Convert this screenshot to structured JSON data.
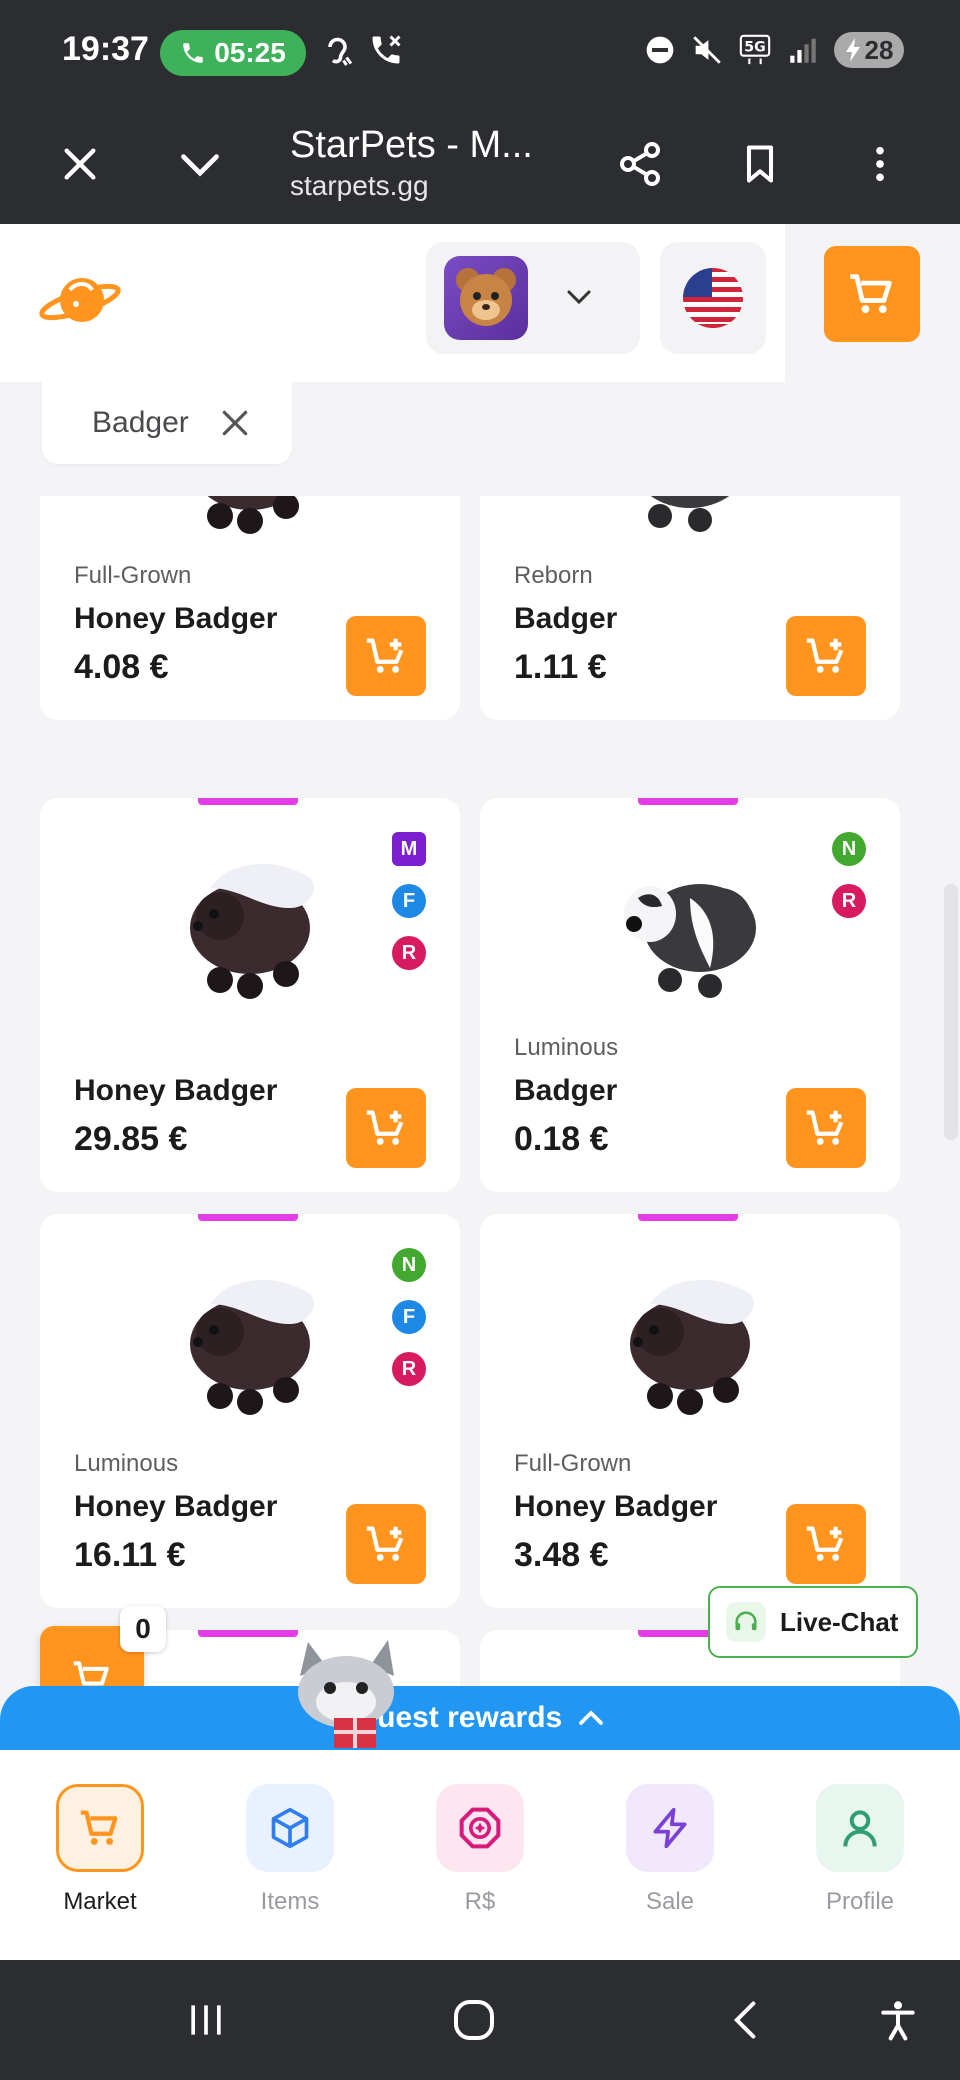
{
  "status_bar": {
    "time": "19:37",
    "call_timer": "05:25",
    "battery": "28"
  },
  "browser": {
    "title": "StarPets - M...",
    "url": "starpets.gg"
  },
  "filter": {
    "chip_label": "Badger"
  },
  "products": [
    {
      "subtitle": "Full-Grown",
      "name": "Honey Badger",
      "price": "4.08 €",
      "badges": []
    },
    {
      "subtitle": "Reborn",
      "name": "Badger",
      "price": "1.11 €",
      "badges": []
    },
    {
      "subtitle": "",
      "name": "Honey Badger",
      "price": "29.85 €",
      "badges": [
        {
          "letter": "M",
          "color": "#7b1fd1"
        },
        {
          "letter": "F",
          "color": "#1e88e5"
        },
        {
          "letter": "R",
          "color": "#d81b60"
        }
      ]
    },
    {
      "subtitle": "Luminous",
      "name": "Badger",
      "price": "0.18 €",
      "badges": [
        {
          "letter": "N",
          "color": "#43a82f"
        },
        {
          "letter": "R",
          "color": "#d81b60"
        }
      ]
    },
    {
      "subtitle": "Luminous",
      "name": "Honey Badger",
      "price": "16.11 €",
      "badges": [
        {
          "letter": "N",
          "color": "#43a82f"
        },
        {
          "letter": "F",
          "color": "#1e88e5"
        },
        {
          "letter": "R",
          "color": "#d81b60"
        }
      ]
    },
    {
      "subtitle": "Full-Grown",
      "name": "Honey Badger",
      "price": "3.48 €",
      "badges": []
    }
  ],
  "floating": {
    "cart_count": "0",
    "live_chat_label": "Live-Chat",
    "quest_label": "Quest rewards"
  },
  "bottom_nav": [
    {
      "label": "Market",
      "icon": "cart-icon",
      "active": true
    },
    {
      "label": "Items",
      "icon": "cube-icon",
      "active": false
    },
    {
      "label": "R$",
      "icon": "robux-icon",
      "active": false
    },
    {
      "label": "Sale",
      "icon": "lightning-icon",
      "active": false
    },
    {
      "label": "Profile",
      "icon": "user-icon",
      "active": false
    }
  ],
  "colors": {
    "accent": "#ff951f",
    "quest_blue": "#2196f3",
    "live_chat_border": "#4caf50",
    "badge_bar": "#e43de8"
  }
}
